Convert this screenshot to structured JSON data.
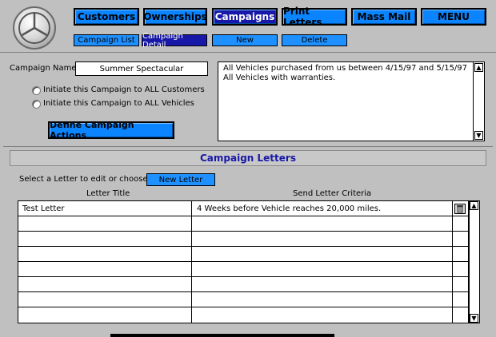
{
  "nav": {
    "tabs": [
      {
        "label": "Customers"
      },
      {
        "label": "Ownerships"
      },
      {
        "label": "Campaigns"
      },
      {
        "label": "Print Letters"
      },
      {
        "label": "Mass Mail"
      },
      {
        "label": "MENU"
      }
    ],
    "active_tab": "Campaigns",
    "subtabs": [
      {
        "label": "Campaign List"
      },
      {
        "label": "Campaign Detail"
      },
      {
        "label": "New"
      },
      {
        "label": "Delete"
      }
    ],
    "active_subtab": "Campaign Detail"
  },
  "campaign": {
    "name_label": "Campaign Name",
    "name_value": "Summer Spectacular",
    "option_customers": "Initiate this Campaign to ALL Customers",
    "option_vehicles": "Initiate this Campaign to ALL Vehicles",
    "define_actions_label": "Define Campaign Actions",
    "criteria_lines": [
      "All Vehicles purchased from us between 4/15/97 and 5/15/97",
      "All Vehicles with warranties."
    ]
  },
  "letters": {
    "section_title": "Campaign Letters",
    "select_prompt": "Select a Letter to edit or choose:",
    "new_letter_label": "New Letter",
    "col_title": "Letter Title",
    "col_criteria": "Send Letter Criteria",
    "rows": [
      {
        "title": "Test Letter",
        "criteria": "4 Weeks before Vehicle reaches 20,000 miles."
      }
    ]
  },
  "colors": {
    "nav_button": "#0a84ff",
    "nav_active": "#1818a8",
    "background": "#c0c0c0"
  },
  "icons": [
    "mercedes-logo-icon",
    "trash-icon",
    "scroll-up-arrow-icon",
    "scroll-down-arrow-icon"
  ]
}
